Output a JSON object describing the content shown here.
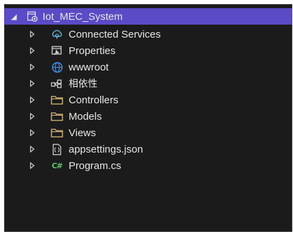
{
  "project": {
    "name": "Iot_MEC_System",
    "expander": "◢",
    "icon": "project-icon"
  },
  "colors": {
    "selection": "#5a4bc6",
    "background": "#1b1b1c",
    "text": "#e7e7e7",
    "connected": "#5fb5d6",
    "globe": "#3f8fe6",
    "csharp": "#62c56b"
  },
  "items": [
    {
      "label": "Connected Services",
      "icon": "connected-services-icon"
    },
    {
      "label": "Properties",
      "icon": "properties-wrench-icon"
    },
    {
      "label": "wwwroot",
      "icon": "globe-icon"
    },
    {
      "label": "相依性",
      "icon": "dependencies-icon"
    },
    {
      "label": "Controllers",
      "icon": "folder-icon"
    },
    {
      "label": "Models",
      "icon": "folder-icon"
    },
    {
      "label": "Views",
      "icon": "folder-icon"
    },
    {
      "label": "appsettings.json",
      "icon": "json-file-icon"
    },
    {
      "label": "Program.cs",
      "icon": "csharp-file-icon",
      "glyph": "C#"
    }
  ]
}
